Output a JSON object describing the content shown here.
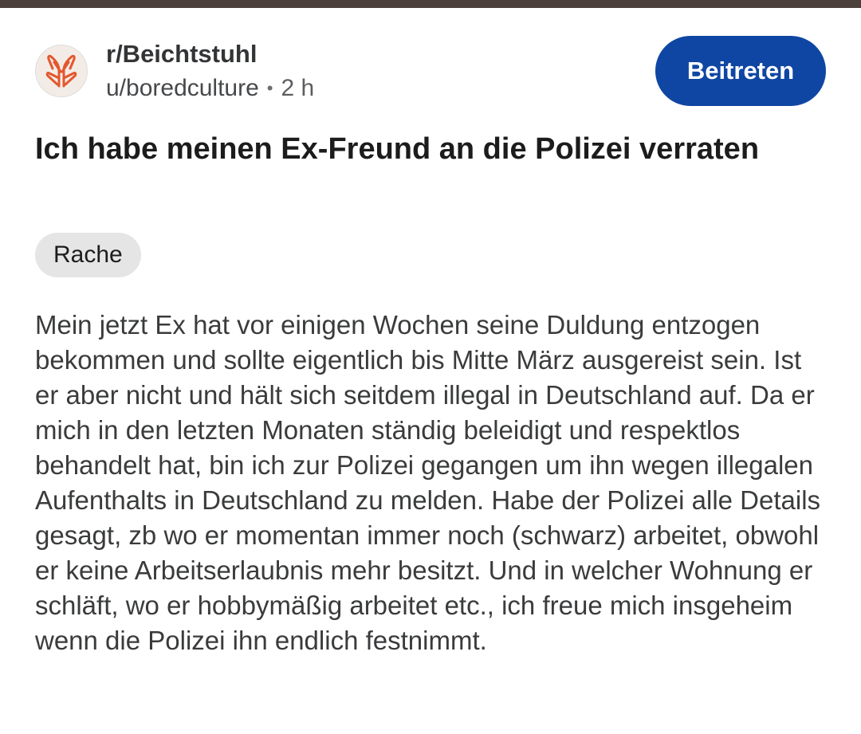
{
  "post": {
    "subreddit": "r/Beichtstuhl",
    "username": "u/boredculture",
    "separator": "•",
    "time": "2 h",
    "join_label": "Beitreten",
    "title": "Ich habe meinen Ex-Freund an die Polizei verraten",
    "flair": "Rache",
    "body": "Mein jetzt Ex hat vor einigen Wochen seine Duldung entzogen bekommen und sollte eigentlich bis Mitte März ausgereist sein. Ist er aber nicht und hält sich seitdem illegal in Deutschland auf. Da er mich in den letzten Monaten ständig beleidigt und respektlos behandelt hat, bin ich zur Polizei gegangen um ihn wegen illegalen Aufenthalts in Deutschland zu melden. Habe der Polizei alle Details gesagt, zb wo er momentan immer noch (schwarz) arbeitet, obwohl er keine Arbeitserlaubnis mehr besitzt. Und in welcher Wohnung er schläft, wo er hobbymäßig arbeitet etc., ich freue mich insgeheim wenn die Polizei ihn endlich festnimmt."
  },
  "icons": {
    "avatar": "praying-hands-icon"
  },
  "colors": {
    "join_button": "#0f46a3",
    "avatar_icon": "#e4572e",
    "flair_bg": "#e5e5e6"
  }
}
